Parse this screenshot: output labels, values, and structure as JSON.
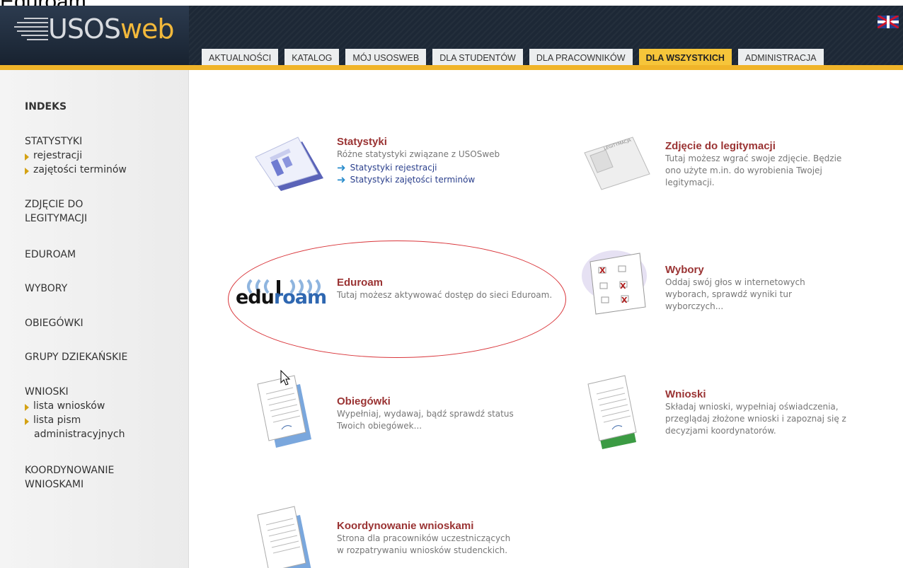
{
  "page_caption": "Eduroam",
  "logo": {
    "text_main": "USOS",
    "text_accent": "web"
  },
  "nav": {
    "tabs": [
      {
        "label": "AKTUALNOŚCI"
      },
      {
        "label": "KATALOG"
      },
      {
        "label": "MÓJ USOSWEB"
      },
      {
        "label": "DLA STUDENTÓW"
      },
      {
        "label": "DLA PRACOWNIKÓW"
      },
      {
        "label": "DLA WSZYSTKICH",
        "active": true
      },
      {
        "label": "ADMINISTRACJA"
      }
    ]
  },
  "sidebar": {
    "index_title": "INDEKS",
    "statystyki": {
      "head": "STATYSTYKI",
      "subs": [
        "rejestracji",
        "zajętości terminów"
      ]
    },
    "zdjecie": {
      "head_line1": "ZDJĘCIE DO",
      "head_line2": "LEGITYMACJI"
    },
    "eduroam": "EDUROAM",
    "wybory": "WYBORY",
    "obiegowki": "OBIEGÓWKI",
    "grupy": "GRUPY DZIEKAŃSKIE",
    "wnioski": {
      "head": "WNIOSKI",
      "subs": [
        "lista wniosków",
        "lista pism"
      ],
      "sub_cont": "administracyjnych"
    },
    "koordynowanie": {
      "line1": "KOORDYNOWANIE",
      "line2": "WNIOSKAMI"
    }
  },
  "items": {
    "statystyki": {
      "title": "Statystyki",
      "desc": "Różne statystyki związane z USOSweb",
      "links": [
        "Statystyki rejestracji",
        "Statystyki zajętości terminów"
      ]
    },
    "zdjecie": {
      "title": "Zdjęcie do legitymacji",
      "desc_lines": [
        "Tutaj możesz wgrać swoje zdjęcie. Będzie",
        "ono użyte m.in. do wyrobienia Twojej",
        "legitymacji."
      ]
    },
    "eduroam": {
      "title": "Eduroam",
      "desc": "Tutaj możesz aktywować dostęp do sieci Eduroam.",
      "logo_text_edu": "edu",
      "logo_text_roam": "roam"
    },
    "wybory": {
      "title": "Wybory",
      "desc_lines": [
        "Oddaj swój głos w internetowych",
        "wyborach, sprawdź wyniki tur",
        "wyborczych..."
      ]
    },
    "obiegowki": {
      "title": "Obiegówki",
      "desc_lines": [
        "Wypełniaj, wydawaj, bądź sprawdź status",
        "Twoich obiegówek..."
      ]
    },
    "wnioski": {
      "title": "Wnioski",
      "desc_lines": [
        "Składaj wnioski, wypełniaj oświadczenia,",
        "przeglądaj złożone wnioski i zapoznaj się z",
        "decyzjami koordynatorów."
      ]
    },
    "koordynowanie": {
      "title": "Koordynowanie wnioskami",
      "desc_lines": [
        "Strona dla pracowników uczestniczących",
        "w rozpatrywaniu wniosków studenckich."
      ]
    }
  },
  "colors": {
    "accent": "#f0b429",
    "title": "#9a3333",
    "link": "#2a3f8c",
    "header_bg": "#1d2836",
    "annotation": "#d9353a"
  }
}
